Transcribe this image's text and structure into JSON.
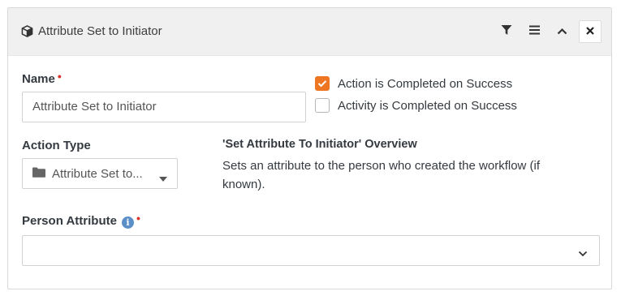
{
  "header": {
    "title": "Attribute Set to Initiator",
    "icon": "cube-icon",
    "actions": [
      "filter-icon",
      "menu-icon",
      "chevron-up-icon",
      "close-icon"
    ]
  },
  "name_field": {
    "label": "Name",
    "required_mark": "•",
    "value": "Attribute Set to Initiator"
  },
  "options": [
    {
      "label": "Action is Completed on Success",
      "checked": true
    },
    {
      "label": "Activity is Completed on Success",
      "checked": false
    }
  ],
  "action_type": {
    "label": "Action Type",
    "value": "Attribute Set to...",
    "icon": "folder-icon"
  },
  "overview": {
    "title": "'Set Attribute To Initiator' Overview",
    "text": "Sets an attribute to the person who created the workflow (if known)."
  },
  "person_attribute": {
    "label": "Person Attribute",
    "info_glyph": "i",
    "required_mark": "•",
    "value": ""
  },
  "colors": {
    "accent": "#ee7623",
    "required": "#d9362b",
    "info": "#5b8fc7",
    "header_bg": "#f0f0f0"
  }
}
